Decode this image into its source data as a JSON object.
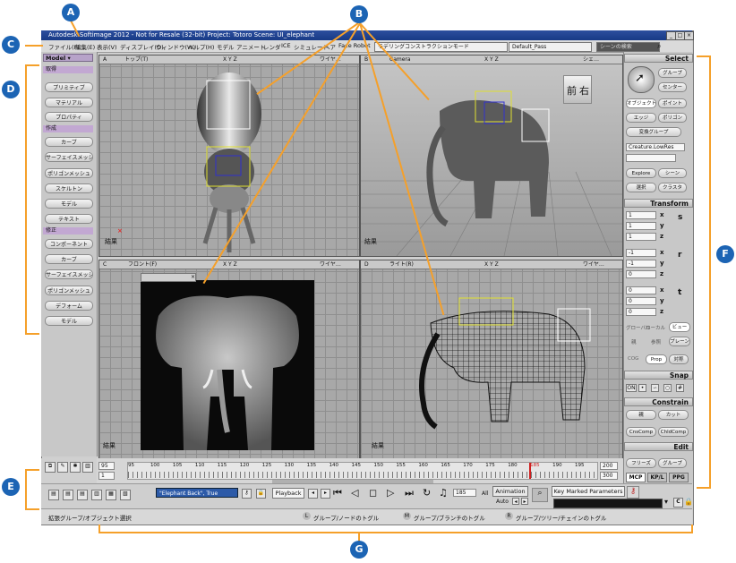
{
  "window": {
    "title": "Autodesk Softimage 2012 - Not for Resale (32-bit)   Project: Totoro   Scene: UI_elephant",
    "controls": [
      "_",
      "□",
      "×"
    ]
  },
  "menu": {
    "items": [
      "ファイル(F)",
      "編集(E)",
      "表示(V)",
      "ディスプレイ(D)",
      "ウィンドウ(W)",
      "ヘルプ(H)",
      "モデル",
      "アニメート",
      "レンダ",
      "ICE",
      "シミュレート",
      "ヘア",
      "Face Robot"
    ],
    "mode_dropdown": "モデリングコンストラクションモード",
    "pass_dropdown": "Default_Pass",
    "scene_search_placeholder": "シーンの検索"
  },
  "left_panel": {
    "module": "Model",
    "sections": [
      {
        "title": "取得",
        "buttons": [
          "プリミティブ",
          "マテリアル",
          "プロパティ"
        ]
      },
      {
        "title": "作成",
        "buttons": [
          "カーブ",
          "サーフェイスメッシュ",
          "ポリゴンメッシュ",
          "スケルトン",
          "モデル",
          "テキスト"
        ]
      },
      {
        "title": "修正",
        "buttons": [
          "コンポーネント",
          "カーブ",
          "サーフェイスメッシュ",
          "ポリゴンメッシュ",
          "デフォーム",
          "モデル"
        ]
      }
    ]
  },
  "viewports": [
    {
      "id": "A",
      "view": "トップ(T)",
      "right": "ワイヤ…",
      "result": "結果",
      "axes": "X Y Z"
    },
    {
      "id": "B",
      "view": "Camera",
      "right": "シェ…",
      "result": "結果",
      "axes": "X Y Z",
      "cube": [
        "前",
        "右"
      ]
    },
    {
      "id": "C",
      "view": "フロント(F)",
      "right": "ワイヤ…",
      "result": "結果",
      "axes": "X Y Z"
    },
    {
      "id": "D",
      "view": "ライト(R)",
      "right": "ワイヤ…",
      "result": "結果",
      "axes": "X Y Z"
    }
  ],
  "right_panel": {
    "select": {
      "title": "Select",
      "buttons": [
        "グループ",
        "センター",
        "オブジェクト",
        "ポイント",
        "エッジ",
        "ポリゴン",
        "変換グループ"
      ],
      "object_name": "Creature.LowRes",
      "explore": [
        "Explore",
        "シーン",
        "選択",
        "クラスタ"
      ]
    },
    "transform": {
      "title": "Transform",
      "scale": [
        "1",
        "1",
        "1"
      ],
      "rotate": [
        "-1",
        "-1",
        "0"
      ],
      "translate": [
        "0",
        "0",
        "0"
      ],
      "axis_letters": [
        "x",
        "y",
        "z"
      ],
      "modes": [
        "グローバル",
        "ローカル",
        "ビュー",
        "親",
        "参照",
        "プレーン"
      ],
      "cog": "COG",
      "prop": "Prop",
      "other": "対称"
    },
    "snap": {
      "title": "Snap",
      "on": "ON"
    },
    "constrain": {
      "title": "Constrain",
      "buttons": [
        "親",
        "カット",
        "CnsComp",
        "ChldComp"
      ]
    },
    "edit": {
      "title": "Edit",
      "buttons": [
        "フリーズ",
        "グループ"
      ]
    },
    "tabs": [
      "MCP",
      "KP/L",
      "PPG"
    ]
  },
  "timeline": {
    "start": "95",
    "start2": "1",
    "end": "200",
    "end2": "300",
    "field_mid": "95",
    "ticks": [
      "95",
      "100",
      "105",
      "110",
      "115",
      "120",
      "125",
      "130",
      "135",
      "140",
      "145",
      "150",
      "155",
      "160",
      "165",
      "170",
      "175",
      "180",
      "185",
      "190",
      "195"
    ],
    "current_frame": "185"
  },
  "playback": {
    "keyable_set": "\"Elephant Back\", True",
    "playback_label": "Playback",
    "frame_field": "185",
    "all_label": "All",
    "animation_label": "Animation",
    "auto_label": "Auto",
    "key_marked": "Key Marked Parameters"
  },
  "status": {
    "left": "拡張グループ/オブジェクト選択",
    "l_key": "L",
    "l_text": "グループ/ノードのトグル",
    "m_key": "M",
    "m_text": "グループ/ブランチのトグル",
    "r_key": "R",
    "r_text": "グループ/ツリー/チェインのトグル"
  },
  "callouts": [
    "A",
    "B",
    "C",
    "D",
    "E",
    "F",
    "G"
  ],
  "colors": {
    "callout": "#1c64b4",
    "bracket": "#f5a02a",
    "title_bar": "#1f3f8c",
    "module_purple": "#b7a3c9"
  }
}
